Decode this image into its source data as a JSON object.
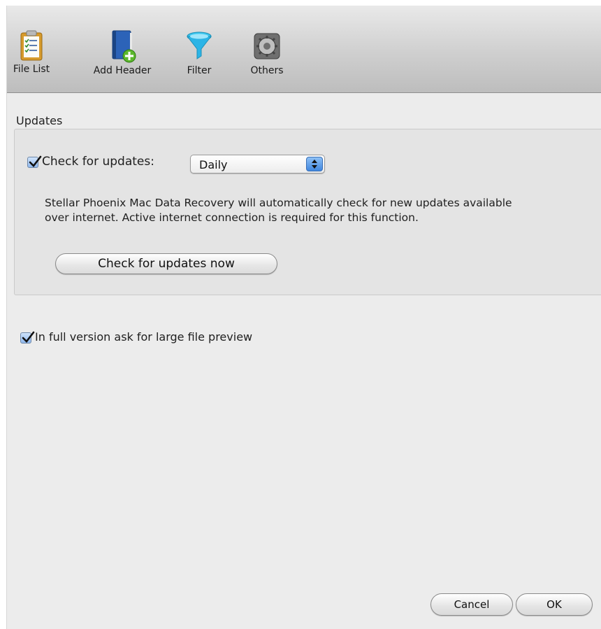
{
  "toolbar": {
    "items": [
      {
        "label": "File List",
        "icon": "clipboard-list-icon"
      },
      {
        "label": "Add Header",
        "icon": "book-add-icon"
      },
      {
        "label": "Filter",
        "icon": "funnel-icon"
      },
      {
        "label": "Others",
        "icon": "gears-icon"
      }
    ]
  },
  "updates": {
    "section_title": "Updates",
    "check_label": "Check for updates:",
    "checked": true,
    "frequency": "Daily",
    "description_line1": "Stellar Phoenix Mac Data Recovery will automatically check for new updates available",
    "description_line2": "over internet. Active internet connection is required for this function.",
    "check_now_button": "Check for updates now"
  },
  "preview": {
    "label": "In full version ask for large file preview",
    "checked": true
  },
  "footer": {
    "cancel_label": "Cancel",
    "ok_label": "OK"
  },
  "colors": {
    "window_bg": "#ececec",
    "group_bg": "#e4e4e4",
    "accent_blue": "#3f86df"
  }
}
